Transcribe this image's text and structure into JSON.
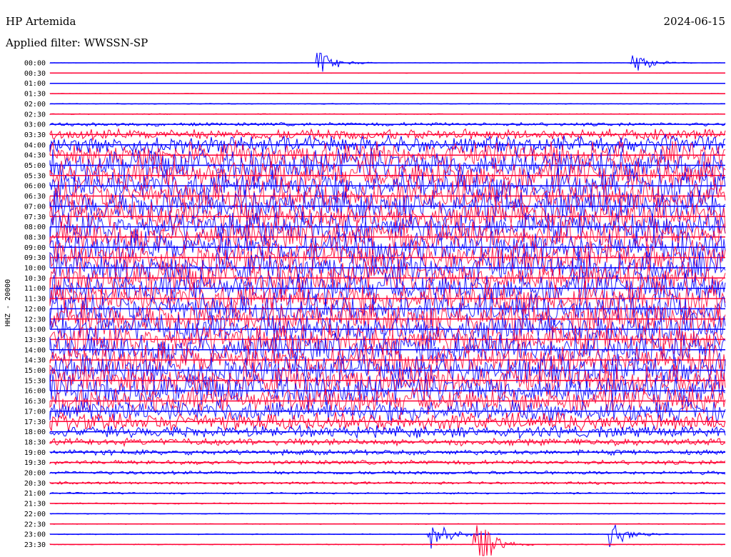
{
  "chart_data": {
    "type": "line",
    "title": "HP Artemida",
    "subtitle": "Applied filter: WWSSN-SP",
    "date": "2024-06-15",
    "ylabel": "HHZ - 20000",
    "y_tick_labels": [
      "00:00",
      "00:30",
      "01:00",
      "01:30",
      "02:00",
      "02:30",
      "03:00",
      "03:30",
      "04:00",
      "04:30",
      "05:00",
      "05:30",
      "06:00",
      "06:30",
      "07:00",
      "07:30",
      "08:00",
      "08:30",
      "09:00",
      "09:30",
      "10:00",
      "10:30",
      "11:00",
      "11:30",
      "12:00",
      "12:30",
      "13:00",
      "13:30",
      "14:00",
      "14:30",
      "15:00",
      "15:30",
      "16:00",
      "16:30",
      "17:00",
      "17:30",
      "18:00",
      "18:30",
      "19:00",
      "19:30",
      "20:00",
      "20:30",
      "21:00",
      "21:30",
      "22:00",
      "22:30",
      "23:00",
      "23:30"
    ],
    "series_colors": [
      "#0000ff",
      "#ff0033"
    ],
    "grid": false,
    "legend": "none",
    "noise_level_by_row": [
      0.05,
      0.05,
      0.05,
      0.05,
      0.1,
      0.1,
      0.4,
      1.2,
      2.0,
      3.0,
      3.5,
      3.5,
      3.5,
      3.5,
      3.5,
      3.5,
      3.5,
      3.5,
      3.5,
      3.5,
      3.5,
      3.5,
      3.5,
      3.5,
      3.5,
      3.5,
      3.5,
      3.5,
      3.5,
      3.5,
      3.5,
      3.5,
      3.5,
      3.0,
      2.5,
      2.0,
      1.3,
      0.8,
      0.6,
      0.5,
      0.4,
      0.3,
      0.2,
      0.15,
      0.1,
      0.1,
      0.1,
      0.1
    ],
    "events": [
      {
        "row": 0,
        "time_min": 12,
        "amp": 2.0
      },
      {
        "row": 0,
        "time_min": 26,
        "amp": 1.5
      },
      {
        "row": 46,
        "time_min": 17,
        "amp": 2.5
      },
      {
        "row": 46,
        "time_min": 25,
        "amp": 2.0
      },
      {
        "row": 47,
        "time_min": 19,
        "amp": 4.0
      }
    ]
  }
}
